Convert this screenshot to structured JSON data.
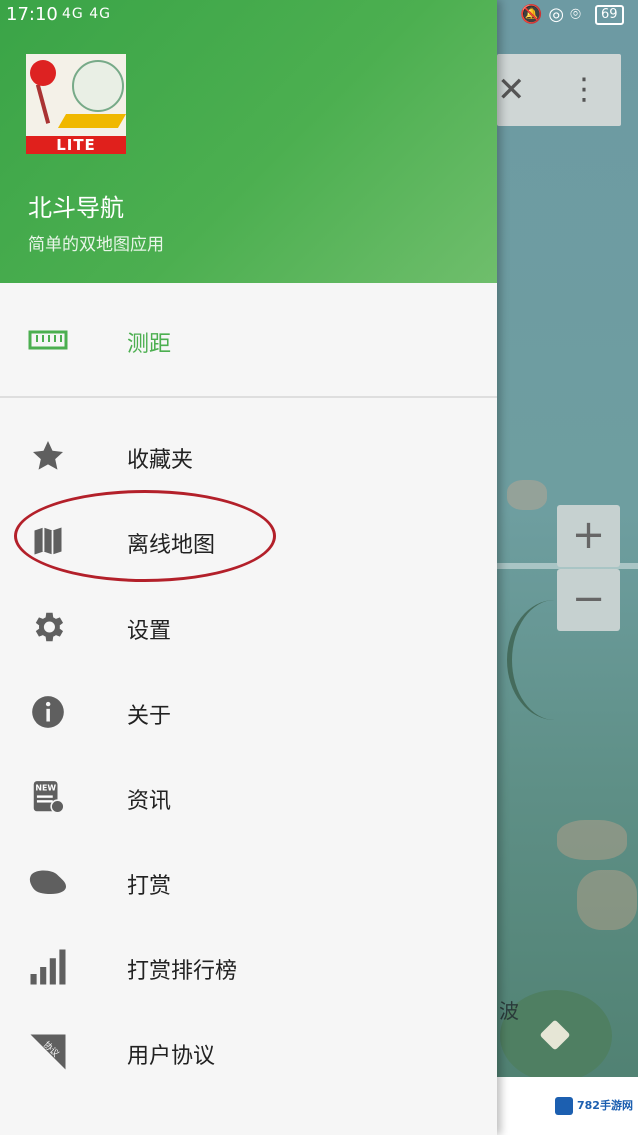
{
  "status_bar": {
    "time": "17:10",
    "network": "4G 4G",
    "battery": "69"
  },
  "drawer": {
    "app_name": "北斗导航",
    "app_subtitle": "简单的双地图应用",
    "badge": "LITE",
    "top_item": {
      "label": "测距",
      "icon": "ruler-icon"
    },
    "items": [
      {
        "label": "收藏夹",
        "icon": "star-icon"
      },
      {
        "label": "离线地图",
        "icon": "map-icon"
      },
      {
        "label": "设置",
        "icon": "gear-icon"
      },
      {
        "label": "关于",
        "icon": "info-icon"
      },
      {
        "label": "资讯",
        "icon": "news-icon"
      },
      {
        "label": "打赏",
        "icon": "money-icon"
      },
      {
        "label": "打赏排行榜",
        "icon": "bar-chart-icon"
      },
      {
        "label": "用户协议",
        "icon": "agreement-icon"
      }
    ]
  },
  "map": {
    "label": "波",
    "zoom_in": "+",
    "zoom_out": "−"
  },
  "watermark": "782手游网",
  "colors": {
    "accent": "#4caf50",
    "highlight_ring": "#b3202a"
  }
}
